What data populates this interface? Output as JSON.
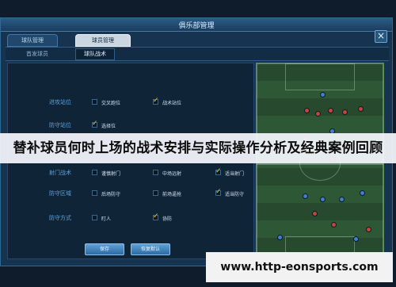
{
  "window": {
    "title": "俱乐部管理"
  },
  "tabs": [
    {
      "label": "球队管理"
    },
    {
      "label": "球员管理"
    }
  ],
  "subtabs": [
    {
      "label": "首发球员"
    },
    {
      "label": "球队战术"
    }
  ],
  "tactics": [
    {
      "label": "进攻站位",
      "options": [
        {
          "text": "交叉跑位",
          "checked": false
        },
        {
          "text": "战术站位",
          "checked": true
        }
      ]
    },
    {
      "label": "防守站位",
      "options": [
        {
          "text": "选择位",
          "checked": true
        }
      ]
    },
    {
      "label": "射门战术",
      "options": [
        {
          "text": "谨慎射门",
          "checked": false
        },
        {
          "text": "中场远射",
          "checked": false
        },
        {
          "text": "适当射门",
          "checked": true
        }
      ]
    },
    {
      "label": "防守区域",
      "options": [
        {
          "text": "后场防守",
          "checked": false
        },
        {
          "text": "前场逼抢",
          "checked": false
        },
        {
          "text": "适当防守",
          "checked": true
        }
      ]
    },
    {
      "label": "防守方式",
      "options": [
        {
          "text": "盯人",
          "checked": false
        },
        {
          "text": "协防",
          "checked": true
        }
      ]
    }
  ],
  "buttons": {
    "save": "保存",
    "restore": "恢复默认"
  },
  "banner": {
    "text": "替补球员何时上场的战术安排与实际操作分析及经典案例回顾"
  },
  "watermark": {
    "text": "www.http-eonsports.com"
  },
  "icons": {
    "close": "close-icon",
    "check": "checkmark-icon"
  },
  "colors": {
    "accent": "#f1c32a",
    "label": "#5fa2dc",
    "team_red": "#c9433b",
    "team_blue": "#3d7fd2"
  }
}
